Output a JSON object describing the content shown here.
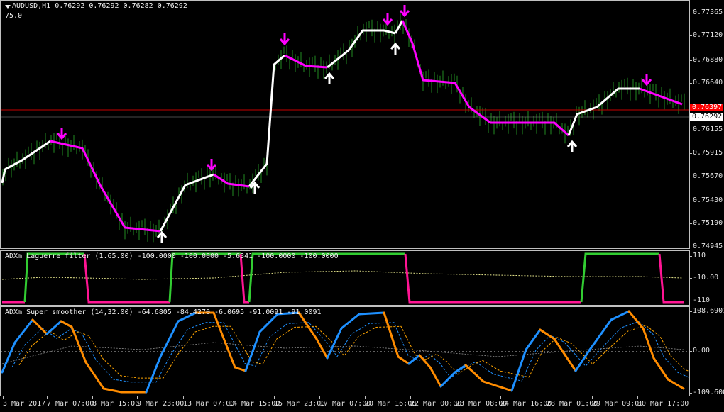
{
  "main": {
    "symbol_info": "AUDUSD,H1  0.76292 0.76292 0.76282 0.76292",
    "sub_label": "75.0",
    "price_ticks": [
      "0.77365",
      "0.77120",
      "0.76880",
      "0.76640",
      "0.76292",
      "0.76155",
      "0.75915",
      "0.75670",
      "0.75430",
      "0.75190",
      "0.74945"
    ],
    "red_level_label": "0.76397",
    "current_price_label": "0.76292",
    "colors": {
      "bars": "#228b22",
      "line_up": "#ffffff",
      "line_down": "#ff00ff",
      "red_line": "#c80000",
      "arrow_up": "#ffffff",
      "arrow_down": "#ff00ff"
    },
    "icons": {
      "arrow_up": "up-arrow-icon",
      "arrow_down": "down-arrow-icon",
      "menu": "triangle-down-icon"
    }
  },
  "laguerre": {
    "title": "ADXm Laguerre filter (1.65.00) -100.0000 -100.0000 -5.6341 -100.0000 -100.0000",
    "ticks": [
      "110",
      "-10.00",
      "-110"
    ],
    "colors": {
      "up": "#32cd32",
      "down": "#ff1493",
      "signal": "#e6e68c"
    }
  },
  "super_smoother": {
    "title": "ADXm Super smoother (14,32.00) -64.6805 -84.4270 -6.0695 -91.0091 -91.0091",
    "ticks": [
      "108.6901",
      "0.00",
      "-109.6005"
    ],
    "colors": {
      "up": "#1e90ff",
      "down": "#ff8c00",
      "dash1": "#1e90ff",
      "dash2": "#ffa500",
      "zero": "#c0c0c0"
    }
  },
  "time_axis": [
    "3 Mar 2017",
    "7 Mar 07:00",
    "8 Mar 15:00",
    "9 Mar 23:00",
    "13 Mar 07:00",
    "14 Mar 15:00",
    "15 Mar 23:00",
    "17 Mar 07:00",
    "20 Mar 16:00",
    "22 Mar 00:00",
    "23 Mar 08:00",
    "24 Mar 16:00",
    "28 Mar 01:00",
    "29 Mar 09:00",
    "30 Mar 17:00"
  ]
}
